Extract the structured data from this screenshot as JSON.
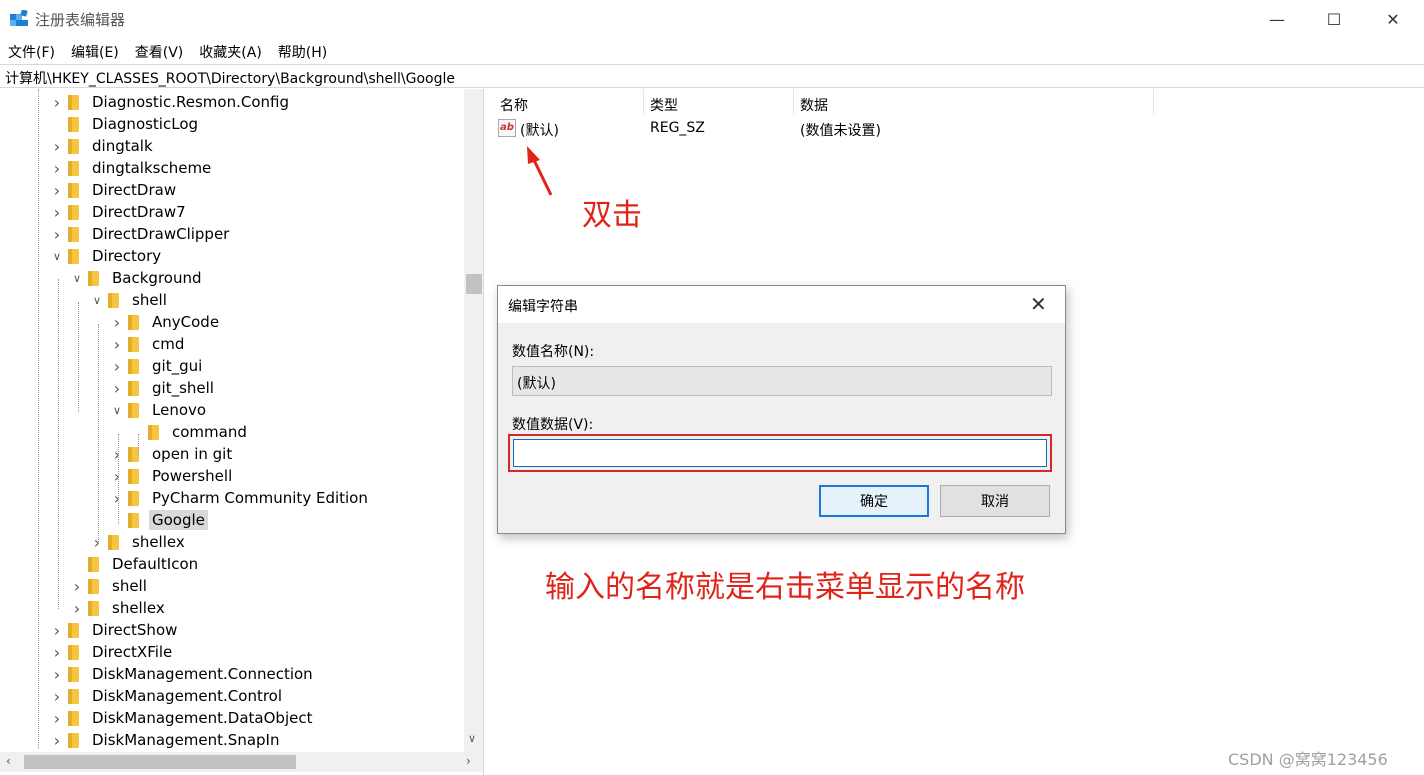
{
  "window": {
    "title": "注册表编辑器",
    "minimize": "—",
    "maximize": "☐",
    "close": "✕"
  },
  "menu": [
    "文件(F)",
    "编辑(E)",
    "查看(V)",
    "收藏夹(A)",
    "帮助(H)"
  ],
  "address": "计算机\\HKEY_CLASSES_ROOT\\Directory\\Background\\shell\\Google",
  "tree": [
    {
      "label": "Diagnostic.Resmon.Config",
      "level": 0,
      "state": "collapsed"
    },
    {
      "label": "DiagnosticLog",
      "level": 0,
      "state": "none"
    },
    {
      "label": "dingtalk",
      "level": 0,
      "state": "collapsed"
    },
    {
      "label": "dingtalkscheme",
      "level": 0,
      "state": "collapsed"
    },
    {
      "label": "DirectDraw",
      "level": 0,
      "state": "collapsed"
    },
    {
      "label": "DirectDraw7",
      "level": 0,
      "state": "collapsed"
    },
    {
      "label": "DirectDrawClipper",
      "level": 0,
      "state": "collapsed"
    },
    {
      "label": "Directory",
      "level": 0,
      "state": "expanded"
    },
    {
      "label": "Background",
      "level": 1,
      "state": "expanded"
    },
    {
      "label": "shell",
      "level": 2,
      "state": "expanded"
    },
    {
      "label": "AnyCode",
      "level": 3,
      "state": "collapsed"
    },
    {
      "label": "cmd",
      "level": 3,
      "state": "collapsed"
    },
    {
      "label": "git_gui",
      "level": 3,
      "state": "collapsed"
    },
    {
      "label": "git_shell",
      "level": 3,
      "state": "collapsed"
    },
    {
      "label": "Lenovo",
      "level": 3,
      "state": "expanded"
    },
    {
      "label": "command",
      "level": 4,
      "state": "none"
    },
    {
      "label": "open in git",
      "level": 3,
      "state": "collapsed"
    },
    {
      "label": "Powershell",
      "level": 3,
      "state": "collapsed"
    },
    {
      "label": "PyCharm Community Edition",
      "level": 3,
      "state": "collapsed"
    },
    {
      "label": "Google",
      "level": 3,
      "state": "none",
      "selected": true
    },
    {
      "label": "shellex",
      "level": 2,
      "state": "collapsed"
    },
    {
      "label": "DefaultIcon",
      "level": 1,
      "state": "none"
    },
    {
      "label": "shell",
      "level": 1,
      "state": "collapsed"
    },
    {
      "label": "shellex",
      "level": 1,
      "state": "collapsed"
    },
    {
      "label": "DirectShow",
      "level": 0,
      "state": "collapsed"
    },
    {
      "label": "DirectXFile",
      "level": 0,
      "state": "collapsed"
    },
    {
      "label": "DiskManagement.Connection",
      "level": 0,
      "state": "collapsed"
    },
    {
      "label": "DiskManagement.Control",
      "level": 0,
      "state": "collapsed"
    },
    {
      "label": "DiskManagement.DataObject",
      "level": 0,
      "state": "collapsed"
    },
    {
      "label": "DiskManagement.SnapIn",
      "level": 0,
      "state": "collapsed"
    }
  ],
  "list": {
    "columns": [
      "名称",
      "类型",
      "数据"
    ],
    "rows": [
      {
        "icon": "ab",
        "name": "(默认)",
        "type": "REG_SZ",
        "data": "(数值未设置)"
      }
    ]
  },
  "annotations": {
    "double_click": "双击",
    "input_note": "输入的名称就是右击菜单显示的名称",
    "color": "#e0241a"
  },
  "dialog": {
    "title": "编辑字符串",
    "close": "✕",
    "value_name_label": "数值名称(N):",
    "value_name": "(默认)",
    "value_data_label": "数值数据(V):",
    "value_data": "",
    "ok": "确定",
    "cancel": "取消"
  },
  "watermark": "CSDN @窝窝123456"
}
